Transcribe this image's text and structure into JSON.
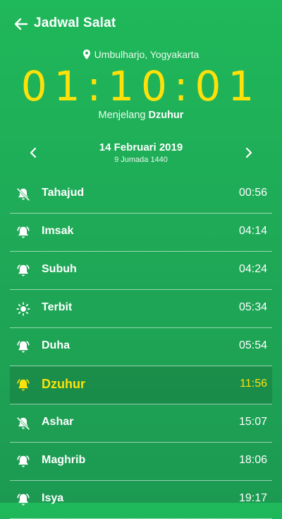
{
  "header": {
    "title": "Jadwal Salat"
  },
  "location": "Umbulharjo, Yogyakarta",
  "countdown": "01:10:01",
  "next_prayer": {
    "prefix": "Menjelang",
    "name": "Dzuhur"
  },
  "date": {
    "gregorian": "14 Februari 2019",
    "hijri": "9 Jumada 1440"
  },
  "colors": {
    "accent": "#ffe10a",
    "background": "#1fb85a"
  },
  "prayers": [
    {
      "name": "Tahajud",
      "time": "00:56",
      "icon": "bell-off-icon"
    },
    {
      "name": "Imsak",
      "time": "04:14",
      "icon": "bell-ring-icon"
    },
    {
      "name": "Subuh",
      "time": "04:24",
      "icon": "bell-ring-icon"
    },
    {
      "name": "Terbit",
      "time": "05:34",
      "icon": "sun-icon"
    },
    {
      "name": "Duha",
      "time": "05:54",
      "icon": "bell-ring-icon"
    },
    {
      "name": "Dzuhur",
      "time": "11:56",
      "icon": "bell-ring-icon",
      "active": true
    },
    {
      "name": "Ashar",
      "time": "15:07",
      "icon": "bell-off-icon"
    },
    {
      "name": "Maghrib",
      "time": "18:06",
      "icon": "bell-ring-icon"
    },
    {
      "name": "Isya",
      "time": "19:17",
      "icon": "bell-ring-icon"
    }
  ]
}
